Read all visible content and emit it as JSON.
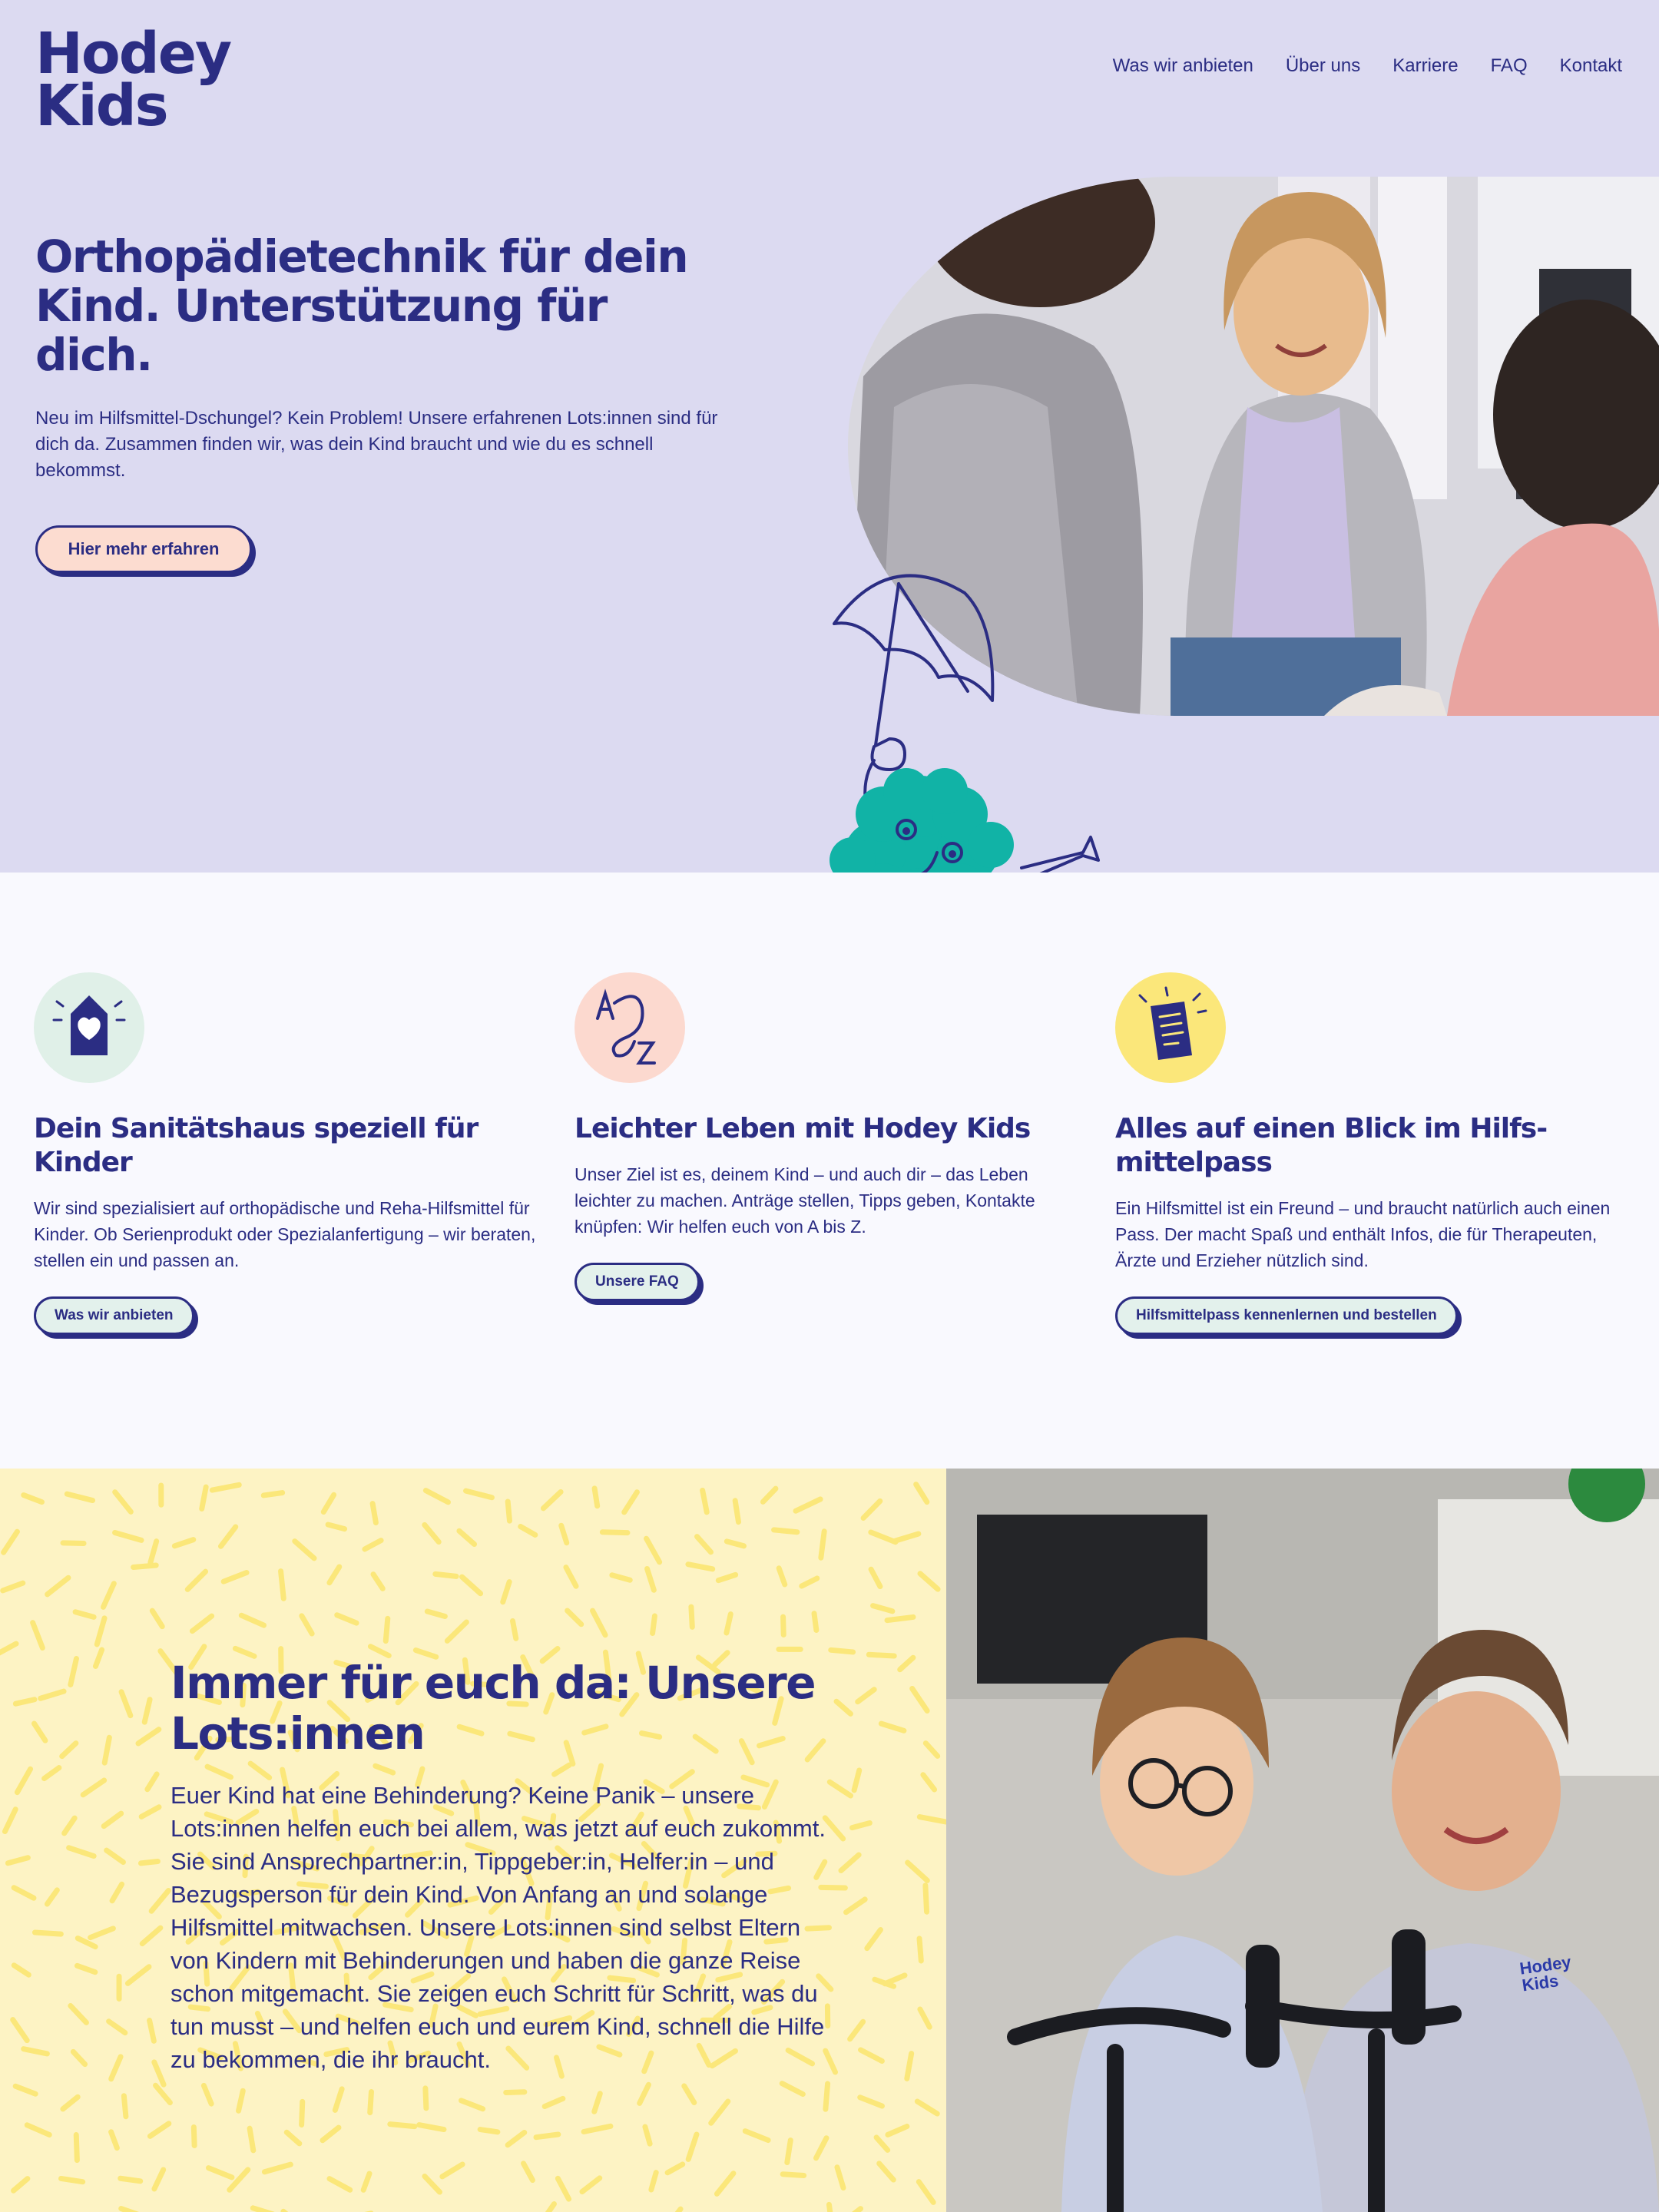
{
  "brand": {
    "line1": "Hodey",
    "line2": "Kids"
  },
  "nav": {
    "items": [
      "Was wir anbieten",
      "Über uns",
      "Karriere",
      "FAQ",
      "Kontakt"
    ]
  },
  "hero": {
    "title": "Orthopädietechnik für dein Kind. Unterstützung für dich.",
    "text": "Neu im Hilfsmittel-Dschungel? Kein Problem! Unsere erfahrenen Lots:innen sind für dich da. Zusammen finden wir, was dein Kind braucht und wie du es schnell bekommst.",
    "button": "Hier mehr erfahren"
  },
  "features": [
    {
      "icon": "heart-house-icon",
      "title": "Dein Sanitätshaus speziell für Kinder",
      "text": "Wir sind spezialisiert auf orthopädische und Reha-Hilfsmittel für Kinder. Ob Serienprodukt oder Spezialanfertigung – wir beraten, stellen ein und passen an.",
      "button": "Was wir anbieten"
    },
    {
      "icon": "a-to-z-icon",
      "title": "Leichter Leben mit Hodey Kids",
      "text": "Unser Ziel ist es, deinem Kind – und auch dir – das Leben leichter zu machen. Anträge stellen, Tipps geben, Kontakte knüpfen: Wir helfen euch von A bis Z.",
      "button": "Unsere FAQ"
    },
    {
      "icon": "document-icon",
      "title": "Alles auf einen Blick im Hilfs-mittelpass",
      "text": "Ein Hilfsmittel ist ein Freund – und braucht natürlich auch einen Pass. Der macht Spaß und enthält Infos, die für Therapeuten, Ärzte und Erzieher nützlich sind.",
      "button": "Hilfsmittelpass kennenlernen und bestellen"
    }
  ],
  "lots": {
    "title": "Immer für euch da: Unsere Lots:innen",
    "text": "Euer Kind hat eine Behinderung? Keine Panik – unsere Lots:innen helfen euch bei allem, was jetzt auf euch zukommt. Sie sind Ansprechpartner:in, Tippgeber:in, Helfer:in – und Bezugsperson für dein Kind. Von Anfang an und solange Hilfsmittel mitwachsen. Unsere Lots:innen sind selbst Eltern von Kindern mit Behinderungen und haben die ganze Reise schon mitgemacht. Sie zeigen euch Schritt für Schritt, was du tun musst – und helfen euch und eurem Kind, schnell die Hilfe zu bekommen, die ihr braucht."
  },
  "photo_badge": {
    "line1": "Hodey",
    "line2": "Kids"
  },
  "colors": {
    "primary": "#2b2d83",
    "hero_bg": "#dcdaf1",
    "section_bg": "#f9f9fe",
    "lots_bg": "#fdf3c4",
    "accent_teal": "#11b3a6",
    "peach": "#fcdcd0",
    "mint": "#e3f1ec",
    "yellow": "#fbe77a"
  }
}
